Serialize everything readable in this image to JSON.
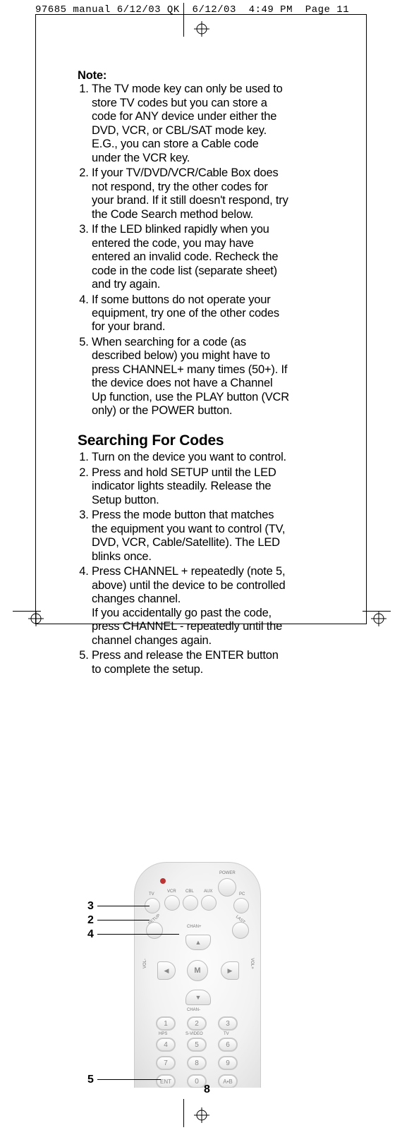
{
  "header": {
    "filename": "97685 manual 6/12/03 QK",
    "date": "6/12/03",
    "time": "4:49 PM",
    "page_ref": "Page 11"
  },
  "note": {
    "title": "Note:",
    "items": [
      "The TV mode key can only be used to store TV codes but you can store a code for ANY device under either the DVD, VCR, or CBL/SAT mode key. E.G., you can store a Cable code under the VCR key.",
      "If your TV/DVD/VCR/Cable Box does not respond, try the other codes for your brand. If it still doesn't respond, try the Code Search method below.",
      "If the LED blinked rapidly when you entered the code, you may have entered an invalid code. Recheck the code in the code list (separate sheet) and try again.",
      "If some buttons do not operate your equipment, try one of the other codes for your brand.",
      "When searching for a code (as described below) you might have to press CHANNEL+ many times (50+). If the device does not have a Channel Up function, use the PLAY button (VCR only) or the POWER button."
    ]
  },
  "search": {
    "title": "Searching For Codes",
    "steps": [
      "Turn on the device you want to control.",
      "Press and hold SETUP until the LED indicator lights steadily. Release the Setup button.",
      "Press the mode button that matches the equipment you want to control (TV, DVD, VCR, Cable/Satellite). The LED blinks once.",
      "Press CHANNEL + repeatedly (note 5, above) until the device to be controlled changes channel.\nIf you accidentally go past the code, press CHANNEL - repeatedly until the channel changes again.",
      "Press and release the ENTER button to complete the setup."
    ]
  },
  "remote": {
    "power": "POWER",
    "modes": {
      "tv": "TV",
      "vcr": "VCR",
      "cbl": "CBL",
      "aux": "AUX",
      "pc": "PC"
    },
    "setup": "SETUP",
    "last": "LAST",
    "chan_plus": "CHAN+",
    "chan_minus": "CHAN-",
    "vol_plus": "VOL+",
    "vol_minus": "VOL-",
    "menu": "M",
    "numpad": {
      "1": "1",
      "2": "2",
      "3": "3",
      "4": "4",
      "5": "5",
      "6": "6",
      "7": "7",
      "8": "8",
      "9": "9",
      "0": "0",
      "ent": "ENT",
      "ab": "A•B"
    },
    "hps_label": "HPS",
    "svideo_label": "S-VIDEO",
    "tv_label": "TV"
  },
  "callouts": {
    "c3": "3",
    "c2": "2",
    "c4": "4",
    "c5": "5"
  },
  "page_number": "8"
}
